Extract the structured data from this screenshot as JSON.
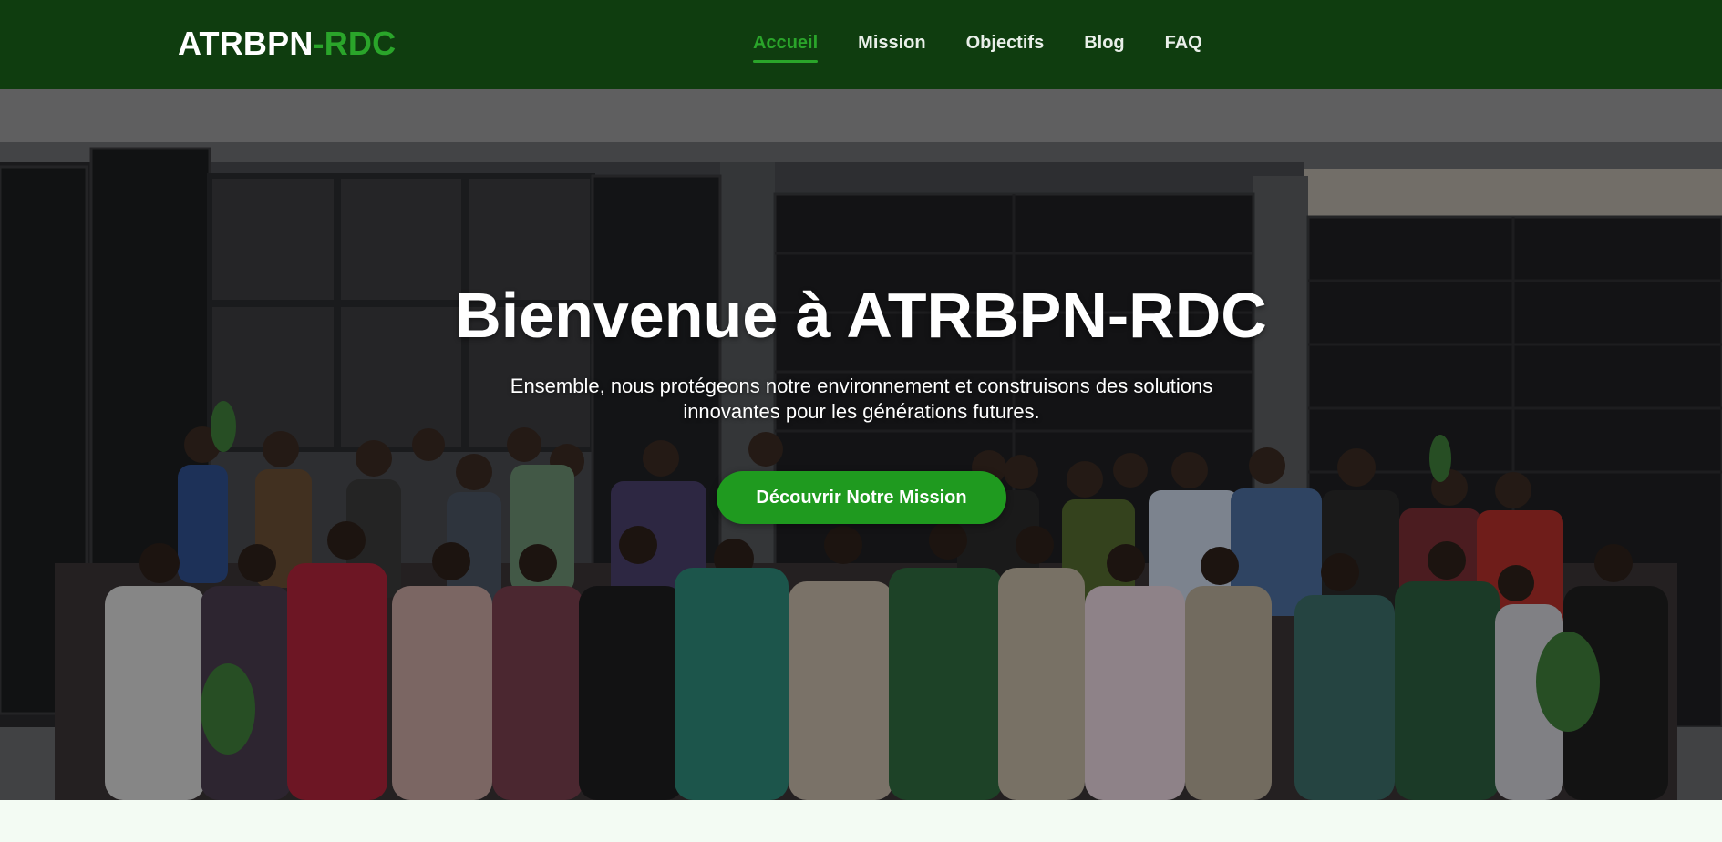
{
  "header": {
    "logo_main": "ATRBPN",
    "logo_accent": "-RDC",
    "nav": [
      {
        "label": "Accueil",
        "active": true
      },
      {
        "label": "Mission",
        "active": false
      },
      {
        "label": "Objectifs",
        "active": false
      },
      {
        "label": "Blog",
        "active": false
      },
      {
        "label": "FAQ",
        "active": false
      }
    ]
  },
  "hero": {
    "title": "Bienvenue à ATRBPN-RDC",
    "subtitle": "Ensemble, nous protégeons notre environnement et construisons des solutions innovantes pour les générations futures.",
    "cta_label": "Découvrir Notre Mission",
    "background_image": "group-photo-in-front-of-black-doors"
  },
  "colors": {
    "header_bg": "#0f3d0f",
    "accent_green": "#2aa52a",
    "cta_bg": "#1f9a1f",
    "text_white": "#ffffff",
    "page_bg": "#f3fbf3"
  }
}
